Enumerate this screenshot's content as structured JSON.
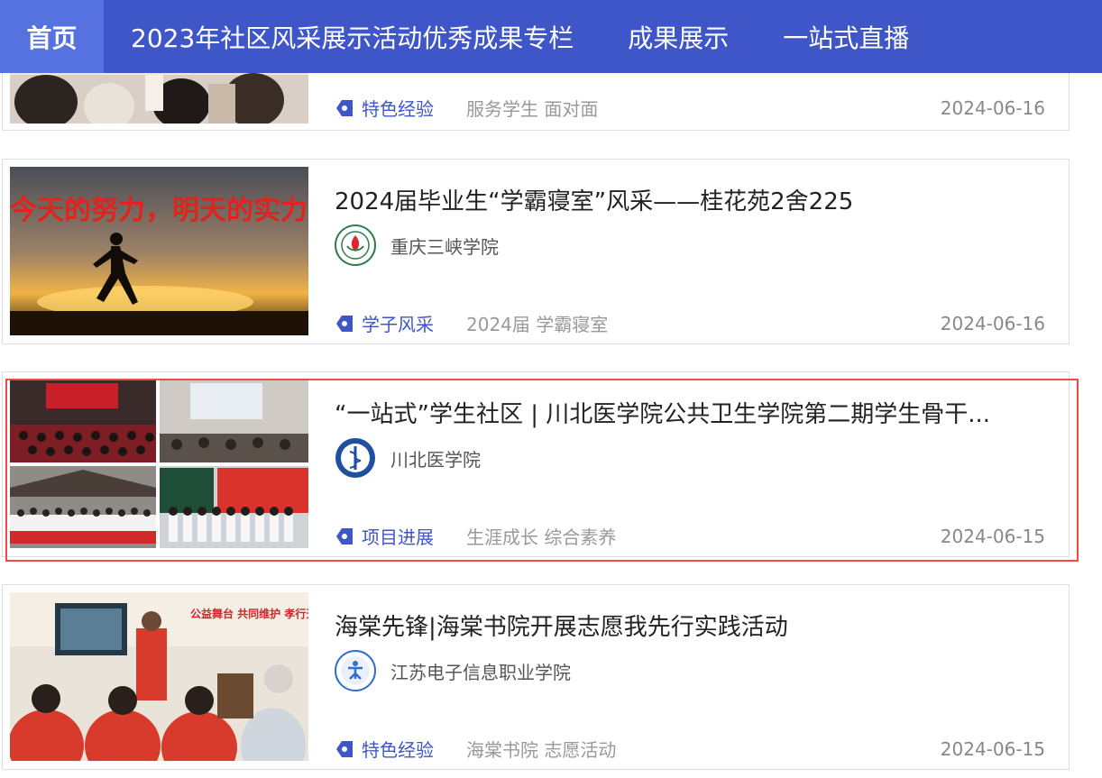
{
  "nav": {
    "items": [
      {
        "label": "首页",
        "active": true
      },
      {
        "label": "2023年社区风采展示活动优秀成果专栏",
        "active": false
      },
      {
        "label": "成果展示",
        "active": false
      },
      {
        "label": "一站式直播",
        "active": false
      }
    ]
  },
  "cards": [
    {
      "title": "",
      "org": "",
      "tag": "特色经验",
      "keywords": "服务学生 面对面",
      "date": "2024-06-16",
      "thumb_icon": "classroom-photo"
    },
    {
      "title": "2024届毕业生“学霸寝室”风采——桂花苑2舍225",
      "org": "重庆三峡学院",
      "tag": "学子风采",
      "keywords": "2024届 学霸寝室",
      "date": "2024-06-16",
      "thumb_text": "今天的努力，明天的实力",
      "thumb_icon": "runner-sunset-photo"
    },
    {
      "title": "“一站式”学生社区 | 川北医学院公共卫生学院第二期学生骨干...",
      "org": "川北医学院",
      "tag": "项目进展",
      "keywords": "生涯成长 综合素养",
      "date": "2024-06-15",
      "thumb_icon": "event-collage-photo"
    },
    {
      "title": "海棠先锋|海棠书院开展志愿我先行实践活动",
      "org": "江苏电子信息职业学院",
      "tag": "特色经验",
      "keywords": "海棠书院 志愿活动",
      "date": "2024-06-15",
      "thumb_text": "公益舞台 共同维护 孝行天下 爱满人间",
      "thumb_icon": "volunteer-photo"
    }
  ],
  "colors": {
    "nav_bg": "#3f56c9",
    "nav_active_bg": "#5672e0",
    "tag": "#3f56c9",
    "highlight": "#f04a4a"
  }
}
